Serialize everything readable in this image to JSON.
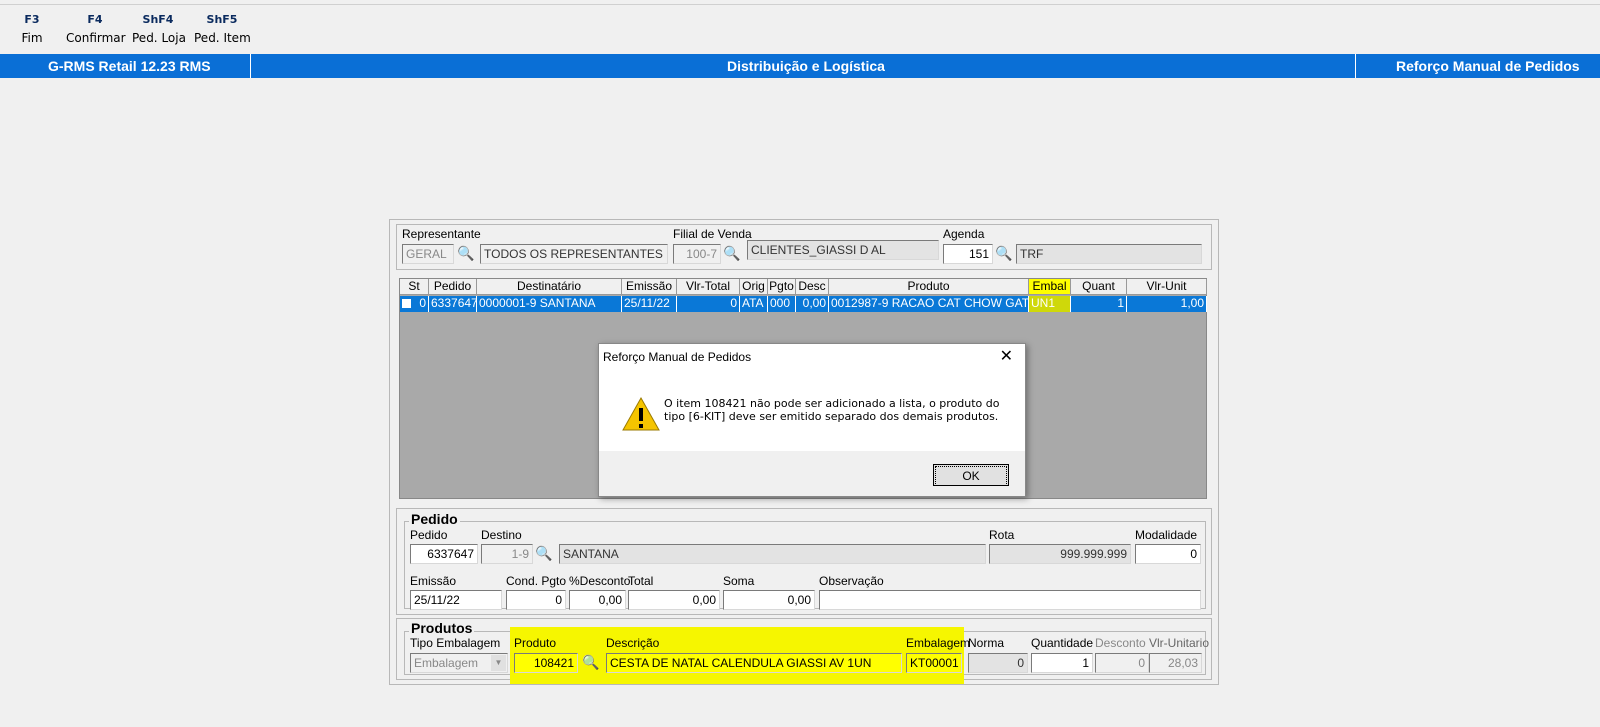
{
  "fkeys": [
    {
      "key": "F3",
      "label": "Fim"
    },
    {
      "key": "F4",
      "label": "Confirmar"
    },
    {
      "key": "ShF4",
      "label": "Ped. Loja"
    },
    {
      "key": "ShF5",
      "label": "Ped. Item"
    }
  ],
  "titlebar": {
    "app": "G-RMS Retail 12.23 RMS",
    "module": "Distribuição e Logística",
    "screen": "Reforço Manual de Pedidos"
  },
  "filters": {
    "representante_label": "Representante",
    "representante_code": "GERAL",
    "representante_name": "TODOS OS REPRESENTANTES",
    "filial_label": "Filial de Venda",
    "filial_code": "100-7",
    "filial_name": "CLIENTES_GIASSI D AL",
    "agenda_label": "Agenda",
    "agenda_code": "151",
    "agenda_name": "TRF"
  },
  "grid": {
    "columns": [
      "St",
      "Pedido",
      "Destinatário",
      "Emissão",
      "Vlr-Total",
      "Orig",
      "Pgto",
      "Desc",
      "Produto",
      "Embal",
      "Quant",
      "Vlr-Unit"
    ],
    "rows": [
      {
        "st": "0",
        "pedido": "6337647",
        "destinatario": "0000001-9 SANTANA",
        "emissao": "25/11/22",
        "vlr_total": "0",
        "orig": "ATA",
        "pgto": "000",
        "desc": "0,00",
        "produto": "0012987-9 RACAO CAT CHOW GATIN",
        "embal": "UN1",
        "quant": "1",
        "vlr_unit": "1,00"
      }
    ]
  },
  "pedido": {
    "section": "Pedido",
    "pedido_label": "Pedido",
    "pedido_value": "6337647",
    "destino_label": "Destino",
    "destino_code": "1-9",
    "destino_name": "SANTANA",
    "rota_label": "Rota",
    "rota_value": "999.999.999",
    "modalidade_label": "Modalidade",
    "modalidade_value": "0",
    "emissao_label": "Emissão",
    "emissao_value": "25/11/22",
    "cond_label": "Cond. Pgto",
    "cond_value": "0",
    "desconto_label": "%Desconto",
    "desconto_value": "0,00",
    "total_label": "Total",
    "total_value": "0,00",
    "soma_label": "Soma",
    "soma_value": "0,00",
    "obs_label": "Observação",
    "obs_value": ""
  },
  "produtos": {
    "section": "Produtos",
    "tipo_label": "Tipo Embalagem",
    "tipo_value": "Embalagem",
    "produto_label": "Produto",
    "produto_value": "108421",
    "descricao_label": "Descrição",
    "descricao_value": "CESTA DE NATAL CALENDULA GIASSI   AV 1UN",
    "embalagem_label": "Embalagem",
    "embalagem_value": "KT00001",
    "norma_label": "Norma",
    "norma_value": "0",
    "quantidade_label": "Quantidade",
    "quantidade_value": "1",
    "desconto_label": "Desconto",
    "desconto_value": "0",
    "vlrunit_label": "Vlr-Unitario",
    "vlrunit_value": "28,03"
  },
  "dialog": {
    "title": "Reforço Manual de Pedidos",
    "message_line1": "O item 108421 não pode ser adicionado a lista, o produto do",
    "message_line2": "tipo [6-KIT] deve ser emitido separado dos demais produtos.",
    "ok": "OK"
  }
}
